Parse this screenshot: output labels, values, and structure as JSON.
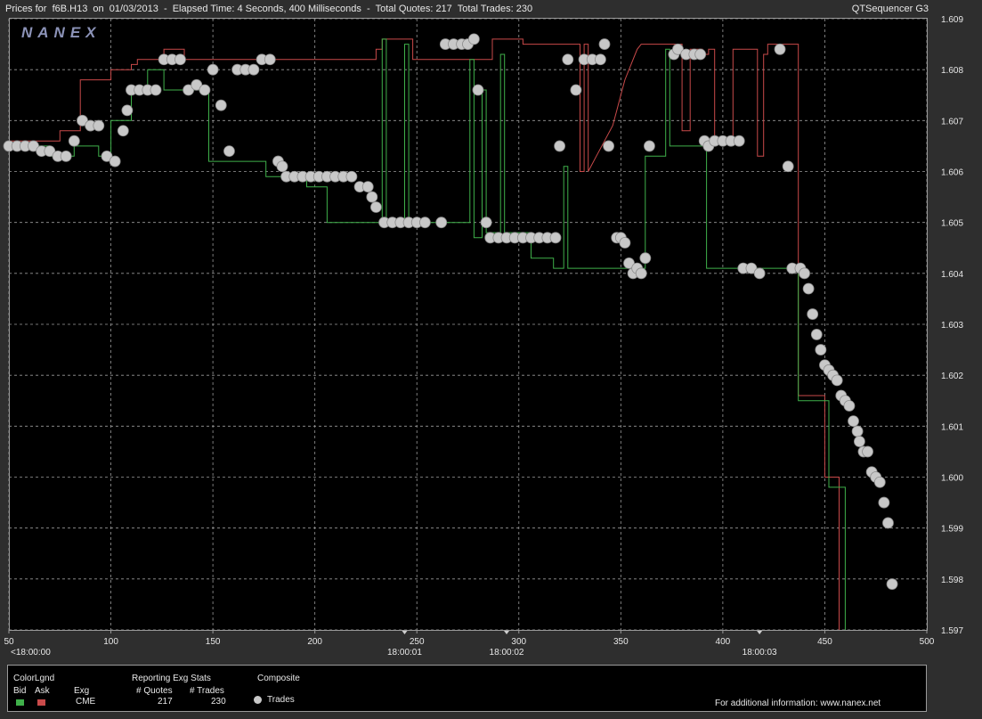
{
  "header": {
    "title": "Prices for  f6B.H13  on  01/03/2013  -  Elapsed Time: 4 Seconds, 400 Milliseconds  -  Total Quotes: 217  Total Trades: 230",
    "app_name": "QTSequencer G3"
  },
  "watermark": "NANEX",
  "colors": {
    "bid": "#3fb04a",
    "ask": "#c94a4a",
    "trade": "#c8c8c8",
    "grid": "#9a9a9a"
  },
  "footer": {
    "color_legend_title": "ColorLgnd",
    "bid_label": "Bid",
    "ask_label": "Ask",
    "exg_label": "Exg",
    "exg_value": "CME",
    "stats_title": "Reporting Exg Stats",
    "quotes_label": "# Quotes",
    "trades_label": "# Trades",
    "quotes_value": "217",
    "trades_value": "230",
    "composite_title": "Composite",
    "trades_legend": "Trades",
    "info": "For additional information: www.nanex.net"
  },
  "chart_data": {
    "type": "line",
    "xlim": [
      50,
      500
    ],
    "ylim": [
      1.597,
      1.609
    ],
    "x_ticks": [
      "50",
      "100",
      "150",
      "200",
      "250",
      "300",
      "350",
      "400",
      "450",
      "500"
    ],
    "y_ticks": [
      "1.597",
      "1.598",
      "1.599",
      "1.600",
      "1.601",
      "1.602",
      "1.603",
      "1.604",
      "1.605",
      "1.606",
      "1.607",
      "1.608",
      "1.609"
    ],
    "time_labels": [
      {
        "x": 50,
        "label": "<18:00:00"
      },
      {
        "x": 244,
        "label": "18:00:01"
      },
      {
        "x": 294,
        "label": "18:00:02"
      },
      {
        "x": 418,
        "label": "18:00:03"
      }
    ],
    "grid": true,
    "series": [
      {
        "name": "Ask",
        "points": [
          [
            50,
            1.6066
          ],
          [
            75,
            1.6066
          ],
          [
            75,
            1.6068
          ],
          [
            85,
            1.6068
          ],
          [
            85,
            1.6078
          ],
          [
            100,
            1.6078
          ],
          [
            100,
            1.608
          ],
          [
            110,
            1.608
          ],
          [
            110,
            1.6081
          ],
          [
            113,
            1.6081
          ],
          [
            113,
            1.6082
          ],
          [
            126,
            1.6082
          ],
          [
            126,
            1.6084
          ],
          [
            136,
            1.6084
          ],
          [
            136,
            1.6082
          ],
          [
            230,
            1.6082
          ],
          [
            230,
            1.6084
          ],
          [
            233,
            1.6084
          ],
          [
            233,
            1.6086
          ],
          [
            248,
            1.6086
          ],
          [
            248,
            1.6082
          ],
          [
            287,
            1.6082
          ],
          [
            287,
            1.6086
          ],
          [
            302,
            1.6086
          ],
          [
            302,
            1.6085
          ],
          [
            330,
            1.6085
          ],
          [
            330,
            1.606
          ],
          [
            332,
            1.606
          ],
          [
            332,
            1.6085
          ],
          [
            334,
            1.6085
          ],
          [
            334,
            1.606
          ],
          [
            338,
            1.6063
          ],
          [
            342,
            1.6066
          ],
          [
            346,
            1.6069
          ],
          [
            348,
            1.6072
          ],
          [
            350,
            1.6075
          ],
          [
            352,
            1.6078
          ],
          [
            355,
            1.6081
          ],
          [
            358,
            1.6084
          ],
          [
            360,
            1.6085
          ],
          [
            380,
            1.6085
          ],
          [
            380,
            1.6068
          ],
          [
            384,
            1.6068
          ],
          [
            384,
            1.6084
          ],
          [
            390,
            1.6084
          ],
          [
            390,
            1.6083
          ],
          [
            393,
            1.6083
          ],
          [
            393,
            1.6084
          ],
          [
            396,
            1.6084
          ],
          [
            396,
            1.6066
          ],
          [
            405,
            1.6066
          ],
          [
            405,
            1.6084
          ],
          [
            417,
            1.6084
          ],
          [
            417,
            1.6063
          ],
          [
            420,
            1.6063
          ],
          [
            420,
            1.6083
          ],
          [
            422,
            1.6083
          ],
          [
            422,
            1.6085
          ],
          [
            437,
            1.6085
          ],
          [
            437,
            1.6016
          ],
          [
            450,
            1.6016
          ],
          [
            450,
            1.6
          ],
          [
            457,
            1.6
          ],
          [
            457,
            1.597
          ]
        ]
      },
      {
        "name": "Bid",
        "points": [
          [
            50,
            1.6065
          ],
          [
            70,
            1.6065
          ],
          [
            70,
            1.6063
          ],
          [
            82,
            1.6063
          ],
          [
            82,
            1.6065
          ],
          [
            94,
            1.6065
          ],
          [
            94,
            1.6063
          ],
          [
            100,
            1.6063
          ],
          [
            100,
            1.607
          ],
          [
            110,
            1.607
          ],
          [
            110,
            1.6076
          ],
          [
            118,
            1.6076
          ],
          [
            118,
            1.608
          ],
          [
            126,
            1.608
          ],
          [
            126,
            1.6076
          ],
          [
            148,
            1.6076
          ],
          [
            148,
            1.6062
          ],
          [
            176,
            1.6062
          ],
          [
            176,
            1.6059
          ],
          [
            196,
            1.6059
          ],
          [
            196,
            1.6057
          ],
          [
            206,
            1.6057
          ],
          [
            206,
            1.605
          ],
          [
            233,
            1.605
          ],
          [
            233,
            1.6086
          ],
          [
            235,
            1.6086
          ],
          [
            235,
            1.605
          ],
          [
            244,
            1.605
          ],
          [
            244,
            1.6085
          ],
          [
            246,
            1.6085
          ],
          [
            246,
            1.605
          ],
          [
            276,
            1.605
          ],
          [
            276,
            1.6082
          ],
          [
            278,
            1.6082
          ],
          [
            278,
            1.6047
          ],
          [
            282,
            1.6047
          ],
          [
            282,
            1.6076
          ],
          [
            284,
            1.6076
          ],
          [
            284,
            1.6048
          ],
          [
            291,
            1.6048
          ],
          [
            291,
            1.6083
          ],
          [
            293,
            1.6083
          ],
          [
            293,
            1.6048
          ],
          [
            306,
            1.6048
          ],
          [
            306,
            1.6043
          ],
          [
            317,
            1.6043
          ],
          [
            317,
            1.6041
          ],
          [
            322,
            1.6041
          ],
          [
            322,
            1.6061
          ],
          [
            324,
            1.6061
          ],
          [
            324,
            1.6041
          ],
          [
            362,
            1.6041
          ],
          [
            362,
            1.6063
          ],
          [
            372,
            1.6063
          ],
          [
            372,
            1.6084
          ],
          [
            374,
            1.6084
          ],
          [
            374,
            1.6065
          ],
          [
            392,
            1.6065
          ],
          [
            392,
            1.6041
          ],
          [
            430,
            1.6041
          ],
          [
            430,
            1.6041
          ],
          [
            437,
            1.6041
          ],
          [
            437,
            1.6015
          ],
          [
            452,
            1.6015
          ],
          [
            452,
            1.5998
          ],
          [
            460,
            1.5998
          ],
          [
            460,
            1.597
          ]
        ]
      },
      {
        "name": "Trades",
        "points": [
          [
            50,
            1.6065
          ],
          [
            54,
            1.6065
          ],
          [
            58,
            1.6065
          ],
          [
            62,
            1.6065
          ],
          [
            66,
            1.6064
          ],
          [
            70,
            1.6064
          ],
          [
            74,
            1.6063
          ],
          [
            78,
            1.6063
          ],
          [
            82,
            1.6066
          ],
          [
            86,
            1.607
          ],
          [
            90,
            1.6069
          ],
          [
            94,
            1.6069
          ],
          [
            98,
            1.6063
          ],
          [
            102,
            1.6062
          ],
          [
            106,
            1.6068
          ],
          [
            108,
            1.6072
          ],
          [
            110,
            1.6076
          ],
          [
            114,
            1.6076
          ],
          [
            118,
            1.6076
          ],
          [
            122,
            1.6076
          ],
          [
            126,
            1.6082
          ],
          [
            130,
            1.6082
          ],
          [
            134,
            1.6082
          ],
          [
            138,
            1.6076
          ],
          [
            142,
            1.6077
          ],
          [
            146,
            1.6076
          ],
          [
            150,
            1.608
          ],
          [
            154,
            1.6073
          ],
          [
            158,
            1.6064
          ],
          [
            162,
            1.608
          ],
          [
            166,
            1.608
          ],
          [
            170,
            1.608
          ],
          [
            174,
            1.6082
          ],
          [
            178,
            1.6082
          ],
          [
            182,
            1.6062
          ],
          [
            184,
            1.6061
          ],
          [
            186,
            1.6059
          ],
          [
            190,
            1.6059
          ],
          [
            194,
            1.6059
          ],
          [
            198,
            1.6059
          ],
          [
            202,
            1.6059
          ],
          [
            206,
            1.6059
          ],
          [
            210,
            1.6059
          ],
          [
            214,
            1.6059
          ],
          [
            218,
            1.6059
          ],
          [
            222,
            1.6057
          ],
          [
            226,
            1.6057
          ],
          [
            228,
            1.6055
          ],
          [
            230,
            1.6053
          ],
          [
            234,
            1.605
          ],
          [
            238,
            1.605
          ],
          [
            242,
            1.605
          ],
          [
            246,
            1.605
          ],
          [
            250,
            1.605
          ],
          [
            254,
            1.605
          ],
          [
            262,
            1.605
          ],
          [
            264,
            1.6085
          ],
          [
            268,
            1.6085
          ],
          [
            272,
            1.6085
          ],
          [
            275,
            1.6085
          ],
          [
            278,
            1.6086
          ],
          [
            280,
            1.6076
          ],
          [
            284,
            1.605
          ],
          [
            286,
            1.6047
          ],
          [
            290,
            1.6047
          ],
          [
            294,
            1.6047
          ],
          [
            298,
            1.6047
          ],
          [
            302,
            1.6047
          ],
          [
            306,
            1.6047
          ],
          [
            310,
            1.6047
          ],
          [
            314,
            1.6047
          ],
          [
            318,
            1.6047
          ],
          [
            320,
            1.6065
          ],
          [
            324,
            1.6082
          ],
          [
            328,
            1.6076
          ],
          [
            332,
            1.6082
          ],
          [
            336,
            1.6082
          ],
          [
            340,
            1.6082
          ],
          [
            342,
            1.6085
          ],
          [
            344,
            1.6065
          ],
          [
            348,
            1.6047
          ],
          [
            350,
            1.6047
          ],
          [
            352,
            1.6046
          ],
          [
            354,
            1.6042
          ],
          [
            356,
            1.604
          ],
          [
            358,
            1.6041
          ],
          [
            360,
            1.604
          ],
          [
            362,
            1.6043
          ],
          [
            364,
            1.6065
          ],
          [
            376,
            1.6083
          ],
          [
            378,
            1.6084
          ],
          [
            382,
            1.6083
          ],
          [
            386,
            1.6083
          ],
          [
            389,
            1.6083
          ],
          [
            391,
            1.6066
          ],
          [
            393,
            1.6065
          ],
          [
            396,
            1.6066
          ],
          [
            400,
            1.6066
          ],
          [
            404,
            1.6066
          ],
          [
            408,
            1.6066
          ],
          [
            410,
            1.6041
          ],
          [
            414,
            1.6041
          ],
          [
            418,
            1.604
          ],
          [
            428,
            1.6084
          ],
          [
            432,
            1.6061
          ],
          [
            434,
            1.6041
          ],
          [
            438,
            1.6041
          ],
          [
            440,
            1.604
          ],
          [
            442,
            1.6037
          ],
          [
            444,
            1.6032
          ],
          [
            446,
            1.6028
          ],
          [
            448,
            1.6025
          ],
          [
            450,
            1.6022
          ],
          [
            452,
            1.6021
          ],
          [
            454,
            1.602
          ],
          [
            456,
            1.6019
          ],
          [
            458,
            1.6016
          ],
          [
            460,
            1.6015
          ],
          [
            462,
            1.6014
          ],
          [
            464,
            1.6011
          ],
          [
            466,
            1.6009
          ],
          [
            467,
            1.6007
          ],
          [
            469,
            1.6005
          ],
          [
            471,
            1.6005
          ],
          [
            473,
            1.6001
          ],
          [
            475,
            1.6
          ],
          [
            477,
            1.5999
          ],
          [
            479,
            1.5995
          ],
          [
            481,
            1.5991
          ],
          [
            483,
            1.5979
          ]
        ]
      }
    ]
  }
}
